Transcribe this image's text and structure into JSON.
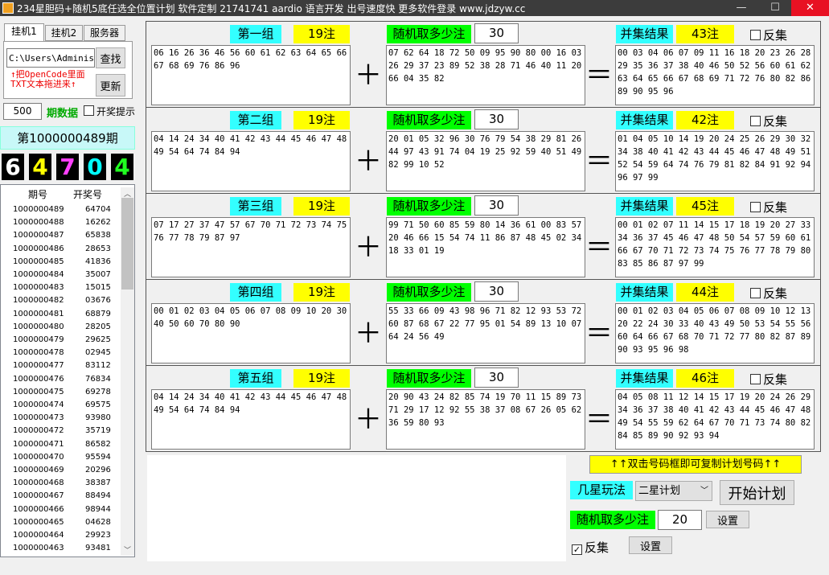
{
  "window": {
    "title": "234星胆码+随机5底任选全位置计划 软件定制 21741741 aardio 语言开发 出号速度快 更多软件登录 www.jdzyw.cc",
    "min": "—",
    "max": "☐",
    "close": "✕"
  },
  "tabs": [
    "挂机1",
    "挂机2",
    "服务器"
  ],
  "left": {
    "path_value": "C:\\Users\\Administ",
    "find_label": "查找",
    "hint1": "↑把OpenCode里面",
    "hint2": "TXT文本拖进来↑",
    "refresh_label": "更新",
    "count": "500",
    "period_label": "期数据",
    "notify_label": "开奖提示",
    "current_period": "第1000000489期",
    "balls": [
      "6",
      "4",
      "7",
      "0",
      "4"
    ],
    "ball_colors": [
      "#ffffff",
      "#ffff00",
      "#ff40ff",
      "#00ffff",
      "#20ff20"
    ],
    "list_header": {
      "period": "期号",
      "number": "开奖号"
    },
    "list": [
      [
        "1000000489",
        "64704"
      ],
      [
        "1000000488",
        "16262"
      ],
      [
        "1000000487",
        "65838"
      ],
      [
        "1000000486",
        "28653"
      ],
      [
        "1000000485",
        "41836"
      ],
      [
        "1000000484",
        "35007"
      ],
      [
        "1000000483",
        "15015"
      ],
      [
        "1000000482",
        "03676"
      ],
      [
        "1000000481",
        "68879"
      ],
      [
        "1000000480",
        "28205"
      ],
      [
        "1000000479",
        "29625"
      ],
      [
        "1000000478",
        "02945"
      ],
      [
        "1000000477",
        "83112"
      ],
      [
        "1000000476",
        "76834"
      ],
      [
        "1000000475",
        "69278"
      ],
      [
        "1000000474",
        "69575"
      ],
      [
        "1000000473",
        "93980"
      ],
      [
        "1000000472",
        "35719"
      ],
      [
        "1000000471",
        "86582"
      ],
      [
        "1000000470",
        "95594"
      ],
      [
        "1000000469",
        "20296"
      ],
      [
        "1000000468",
        "38387"
      ],
      [
        "1000000467",
        "88494"
      ],
      [
        "1000000466",
        "98944"
      ],
      [
        "1000000465",
        "04628"
      ],
      [
        "1000000464",
        "29923"
      ],
      [
        "1000000463",
        "93481"
      ]
    ]
  },
  "groups": [
    {
      "name": "第一组",
      "count": "19注",
      "random_label": "随机取多少注",
      "random_value": "30",
      "result_label": "并集结果",
      "result_count": "43注",
      "reverse": "反集",
      "left": "06 16 26 36 46 56 60 61 62 63 64 65 66 67 68 69 76 86 96",
      "mid": "07 62 64 18 72 50 09 95 90 80 00 16 03 26 29 37 23 89 52 38 28 71 46 40 11 20 66 04 35 82",
      "right": "00 03 04 06 07 09 11 16 18 20 23 26 28 29 35 36 37 38 40 46 50 52 56 60 61 62 63 64 65 66 67 68 69 71 72 76 80 82 86 89 90 95 96"
    },
    {
      "name": "第二组",
      "count": "19注",
      "random_label": "随机取多少注",
      "random_value": "30",
      "result_label": "并集结果",
      "result_count": "42注",
      "reverse": "反集",
      "left": "04 14 24 34 40 41 42 43 44 45 46 47 48 49 54 64 74 84 94",
      "mid": "20 01 05 32 96 30 76 79 54 38 29 81 26 44 97 43 91 74 04 19 25 92 59 40 51 49 82 99 10 52",
      "right": "01 04 05 10 14 19 20 24 25 26 29 30 32 34 38 40 41 42 43 44 45 46 47 48 49 51 52 54 59 64 74 76 79 81 82 84 91 92 94 96 97 99"
    },
    {
      "name": "第三组",
      "count": "19注",
      "random_label": "随机取多少注",
      "random_value": "30",
      "result_label": "并集结果",
      "result_count": "45注",
      "reverse": "反集",
      "left": "07 17 27 37 47 57 67 70 71 72 73 74 75 76 77 78 79 87 97",
      "mid": "99 71 50 60 85 59 80 14 36 61 00 83 57 20 46 66 15 54 74 11 86 87 48 45 02 34 18 33 01 19",
      "right": "00 01 02 07 11 14 15 17 18 19 20 27 33 34 36 37 45 46 47 48 50 54 57 59 60 61 66 67 70 71 72 73 74 75 76 77 78 79 80 83 85 86 87 97 99"
    },
    {
      "name": "第四组",
      "count": "19注",
      "random_label": "随机取多少注",
      "random_value": "30",
      "result_label": "并集结果",
      "result_count": "44注",
      "reverse": "反集",
      "left": "00 01 02 03 04 05 06 07 08 09 10 20 30 40 50 60 70 80 90",
      "mid": "55 33 66 09 43 98 96 71 82 12 93 53 72 60 87 68 67 22 77 95 01 54 89 13 10 07 64 24 56 49",
      "right": "00 01 02 03 04 05 06 07 08 09 10 12 13 20 22 24 30 33 40 43 49 50 53 54 55 56 60 64 66 67 68 70 71 72 77 80 82 87 89 90 93 95 96 98"
    },
    {
      "name": "第五组",
      "count": "19注",
      "random_label": "随机取多少注",
      "random_value": "30",
      "result_label": "并集结果",
      "result_count": "46注",
      "reverse": "反集",
      "left": "04 14 24 34 40 41 42 43 44 45 46 47 48 49 54 64 74 84 94",
      "mid": "20 90 43 24 82 85 74 19 70 11 15 89 73 71 29 17 12 92 55 38 37 08 67 26 05 62 36 59 80 93",
      "right": "04 05 08 11 12 14 15 17 19 20 24 26 29 34 36 37 38 40 41 42 43 44 45 46 47 48 49 54 55 59 62 64 67 70 71 73 74 80 82 84 85 89 90 92 93 94"
    }
  ],
  "bottom": {
    "copy_hint": "↑↑双击号码框即可复制计划号码↑↑",
    "mode_label": "几星玩法",
    "mode_value": "二星计划",
    "start_label": "开始计划",
    "random_label": "随机取多少注",
    "random_value": "20",
    "set_label": "设置",
    "reverse_label": "反集",
    "set2_label": "设置"
  },
  "colors": {
    "cyan": "#33ffff",
    "yellow": "#ffff00",
    "green": "#00ff00"
  }
}
